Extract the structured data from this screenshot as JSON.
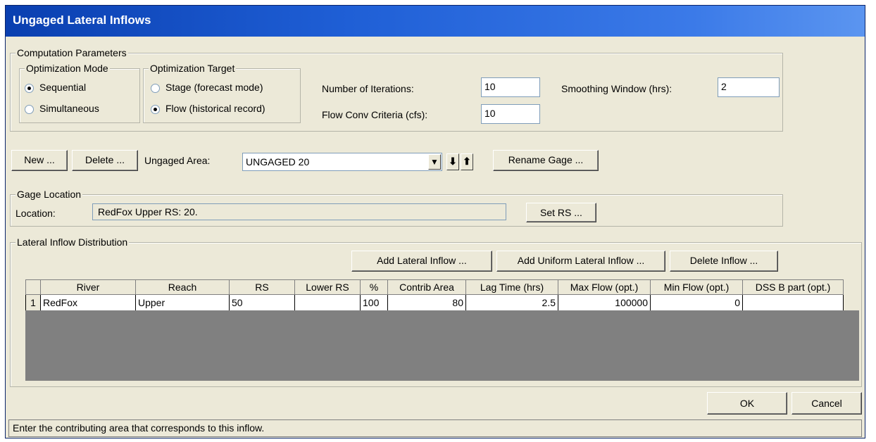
{
  "window": {
    "title": "Ungaged Lateral Inflows"
  },
  "computation": {
    "legend": "Computation Parameters",
    "mode": {
      "legend": "Optimization Mode",
      "options": [
        "Sequential",
        "Simultaneous"
      ],
      "selected": "Sequential"
    },
    "target": {
      "legend": "Optimization Target",
      "options": [
        "Stage (forecast mode)",
        "Flow (historical record)"
      ],
      "selected": "Flow (historical record)"
    },
    "iterations": {
      "label": "Number of Iterations:",
      "value": "10"
    },
    "flow_conv": {
      "label": "Flow Conv Criteria (cfs):",
      "value": "10"
    },
    "smoothing": {
      "label": "Smoothing Window (hrs):",
      "value": "2"
    }
  },
  "toolbar": {
    "new_label": "New ...",
    "delete_label": "Delete ...",
    "area_label": "Ungaged Area:",
    "area_value": "UNGAGED 20",
    "rename_label": "Rename Gage ..."
  },
  "gage_location": {
    "legend": "Gage Location",
    "label": "Location:",
    "value": "RedFox  Upper  RS: 20.",
    "set_rs_label": "Set RS ..."
  },
  "lateral": {
    "legend": "Lateral Inflow Distribution",
    "add_label": "Add Lateral Inflow ...",
    "add_uniform_label": "Add Uniform Lateral Inflow ...",
    "delete_label": "Delete Inflow ...",
    "columns": [
      "River",
      "Reach",
      "RS",
      "Lower RS",
      "%",
      "Contrib Area",
      "Lag Time (hrs)",
      "Max Flow (opt.)",
      "Min Flow (opt.)",
      "DSS B part (opt.)"
    ],
    "rows": [
      {
        "num": "1",
        "river": "RedFox",
        "reach": "Upper",
        "rs": "50",
        "lower_rs": "",
        "pct": "100",
        "contrib_area": "80",
        "lag_time": "2.5",
        "max_flow": "100000",
        "min_flow": "0",
        "dss": ""
      }
    ]
  },
  "footer": {
    "ok_label": "OK",
    "cancel_label": "Cancel",
    "status": "Enter the contributing area that corresponds to this inflow."
  },
  "colors": {
    "titlebar": "#1f5fd6",
    "dialog_bg": "#ece9d8",
    "grid_empty": "#808080"
  }
}
